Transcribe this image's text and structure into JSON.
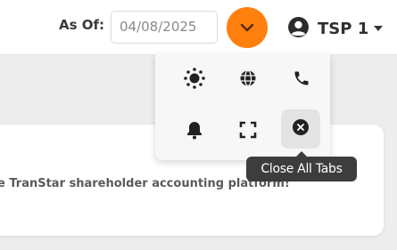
{
  "header": {
    "as_of_label": "As Of:",
    "as_of_date": "04/08/2025",
    "user_name": "TSP 1",
    "accent_color": "#ff7f0f"
  },
  "toolbar_menu": {
    "items": [
      {
        "name": "theme-toggle",
        "icon": "sun-icon"
      },
      {
        "name": "language",
        "icon": "globe-icon"
      },
      {
        "name": "contact",
        "icon": "phone-icon"
      },
      {
        "name": "notifications",
        "icon": "bell-icon"
      },
      {
        "name": "fullscreen",
        "icon": "expand-icon"
      },
      {
        "name": "close-all-tabs",
        "icon": "close-circle-icon",
        "active": true
      }
    ],
    "tooltip": "Close All Tabs"
  },
  "main": {
    "welcome_fragment": "e TranStar shareholder accounting platform!"
  }
}
